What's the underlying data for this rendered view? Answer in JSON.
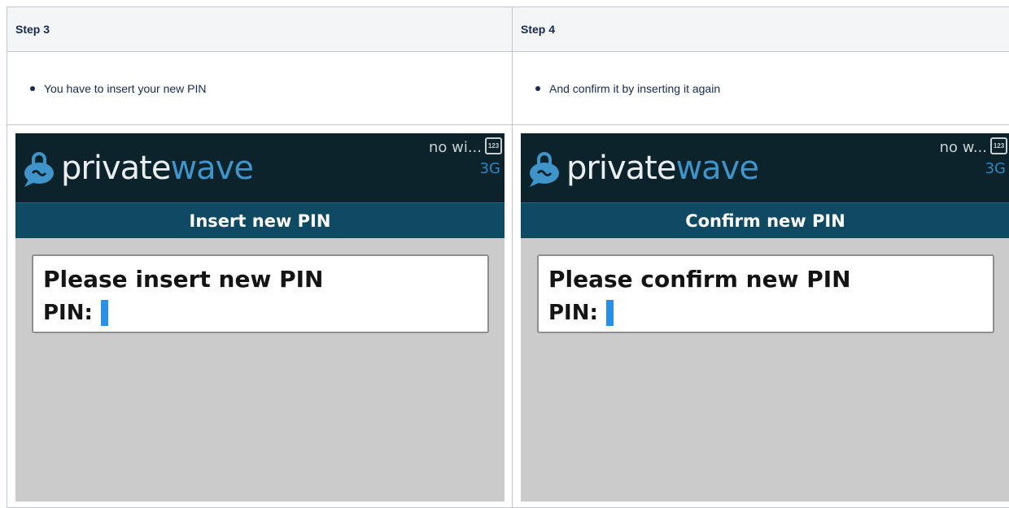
{
  "steps": [
    {
      "heading": "Step 3",
      "bullet": "You have to insert your new PIN",
      "screen": {
        "logo_private": "private",
        "logo_wave": "wave",
        "network": "no wi...",
        "connection": "3G",
        "keypad": "123",
        "title": "Insert new PIN",
        "prompt": "Please insert new PIN",
        "pin_label": "PIN:"
      }
    },
    {
      "heading": "Step 4",
      "bullet": "And confirm it by inserting it again",
      "screen": {
        "logo_private": "private",
        "logo_wave": "wave",
        "network": "no w...",
        "connection": "3G",
        "keypad": "123",
        "title": "Confirm new PIN",
        "prompt": "Please confirm new PIN",
        "pin_label": "PIN:"
      }
    }
  ],
  "colors": {
    "header_bg": "#0c232b",
    "title_bar": "#0f4a63",
    "logo_accent": "#3f94c9",
    "cursor": "#2a8fe6",
    "screen_bg": "#cbcbcb"
  }
}
